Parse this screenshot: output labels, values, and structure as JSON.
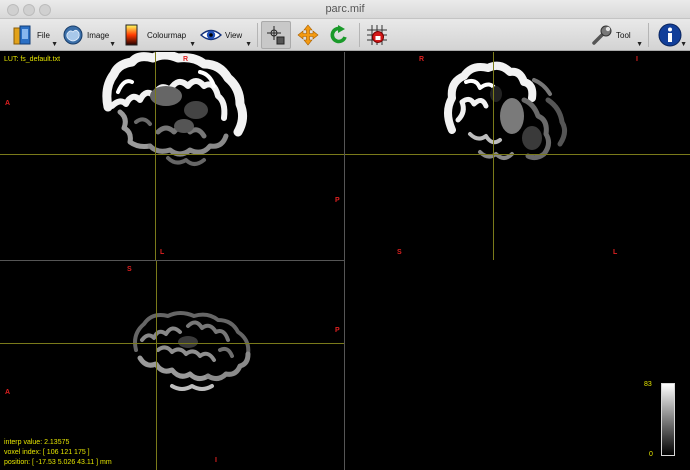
{
  "window": {
    "title": "parc.mif"
  },
  "toolbar": {
    "file_label": "File",
    "image_label": "Image",
    "colourmap_label": "Colourmap",
    "view_label": "View",
    "tool_label": "Tool"
  },
  "overlay": {
    "lut": "LUT: fs_default.txt",
    "interp_value": "interp value: 2.13575",
    "voxel_index": "voxel index: [ 106 121 175 ]",
    "position": "position: [ -17.53 5.026 43.11 ] mm",
    "colorbar_max": "83",
    "colorbar_min": "0"
  },
  "orientation": {
    "axial": {
      "top": "R",
      "left": "A",
      "right": "P",
      "bottom": "L"
    },
    "coronal": {
      "top": "R",
      "right_top": "I",
      "bottom_left": "S",
      "bottom_right": "L"
    },
    "sagittal": {
      "top": "S",
      "left": "A",
      "right": "P",
      "bottom": "I"
    }
  },
  "colors": {
    "crosshair": "#7a7a1a",
    "orientation_label": "#e02020",
    "info_text": "#e6e600"
  }
}
